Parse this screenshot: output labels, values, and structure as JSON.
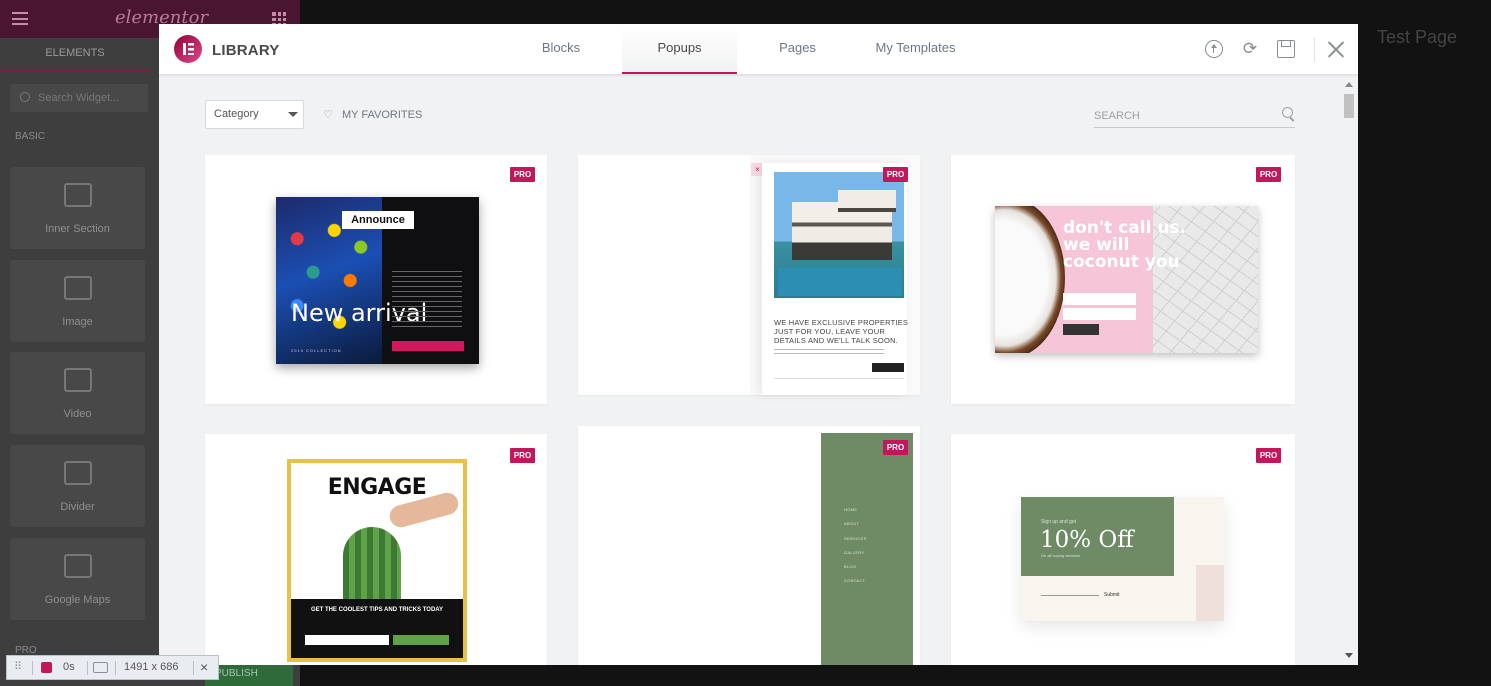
{
  "editor": {
    "logo": "elementor",
    "sidebar_tab": "ELEMENTS",
    "search_placeholder": "Search Widget...",
    "section_basic": "BASIC",
    "widgets": [
      "Inner Section",
      "Image",
      "Video",
      "Divider",
      "Google Maps"
    ],
    "section_pro": "PRO",
    "publish_label": "PUBLISH",
    "page_title": "Test Page"
  },
  "library": {
    "title": "LIBRARY",
    "tabs": [
      {
        "label": "Blocks",
        "active": false
      },
      {
        "label": "Popups",
        "active": true
      },
      {
        "label": "Pages",
        "active": false
      },
      {
        "label": "My Templates",
        "active": false
      }
    ],
    "header_icons": [
      "upload-icon",
      "sync-icon",
      "save-icon",
      "close-icon"
    ],
    "toolbar": {
      "category_value": "Category",
      "favorites_label": "MY FAVORITES",
      "search_placeholder": "SEARCH"
    },
    "pro_badge": "PRO",
    "cards": [
      {
        "announce": "Announce",
        "headline": "New arrival",
        "subline": "2019 COLLECTION"
      },
      {
        "close": "×",
        "headline": "WE HAVE EXCLUSIVE PROPERTIES JUST FOR YOU, LEAVE YOUR DETAILS AND WE'LL TALK SOON."
      },
      {
        "headline": "don't call us. we will coconut you"
      },
      {
        "headline": "ENGAGE",
        "subline": "GET THE COOLEST TIPS AND TRICKS TODAY"
      },
      {
        "menu": [
          "HOME",
          "ABOUT",
          "SERVICES",
          "GALLERY",
          "BLOG",
          "CONTACT"
        ]
      },
      {
        "signup": "Sign up and get",
        "headline": "10% Off",
        "desc": "On all buying services",
        "submit": "Submit"
      }
    ]
  },
  "recorder": {
    "time": "0s",
    "size": "1491 x 686",
    "close": "×"
  },
  "colors": {
    "accent": "#c2185b",
    "overlay": "#121212",
    "sage": "#6e8b65"
  }
}
